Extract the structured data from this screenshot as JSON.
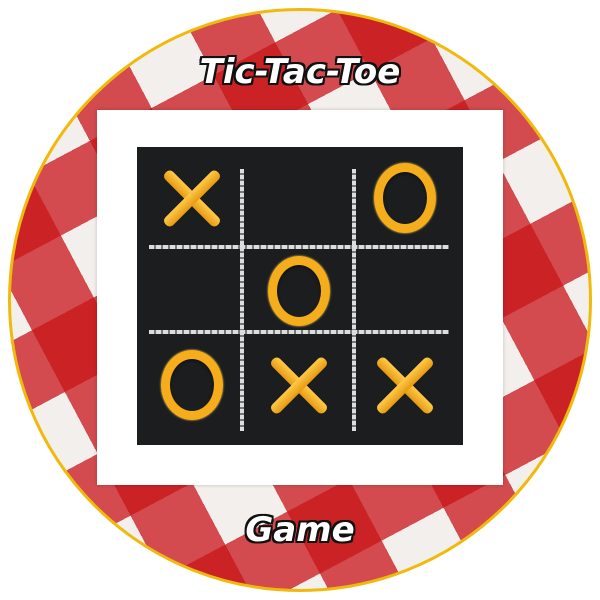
{
  "title": "Tic-Tac-Toe",
  "subtitle": "Game",
  "colors": {
    "ring": "#f0b90b",
    "marks": "#f5ad1c",
    "board": "#1b1d1f",
    "cloth_red": "#c81419"
  },
  "board": [
    [
      "X",
      "",
      "O"
    ],
    [
      "",
      "O",
      ""
    ],
    [
      "O",
      "X",
      "X"
    ]
  ]
}
